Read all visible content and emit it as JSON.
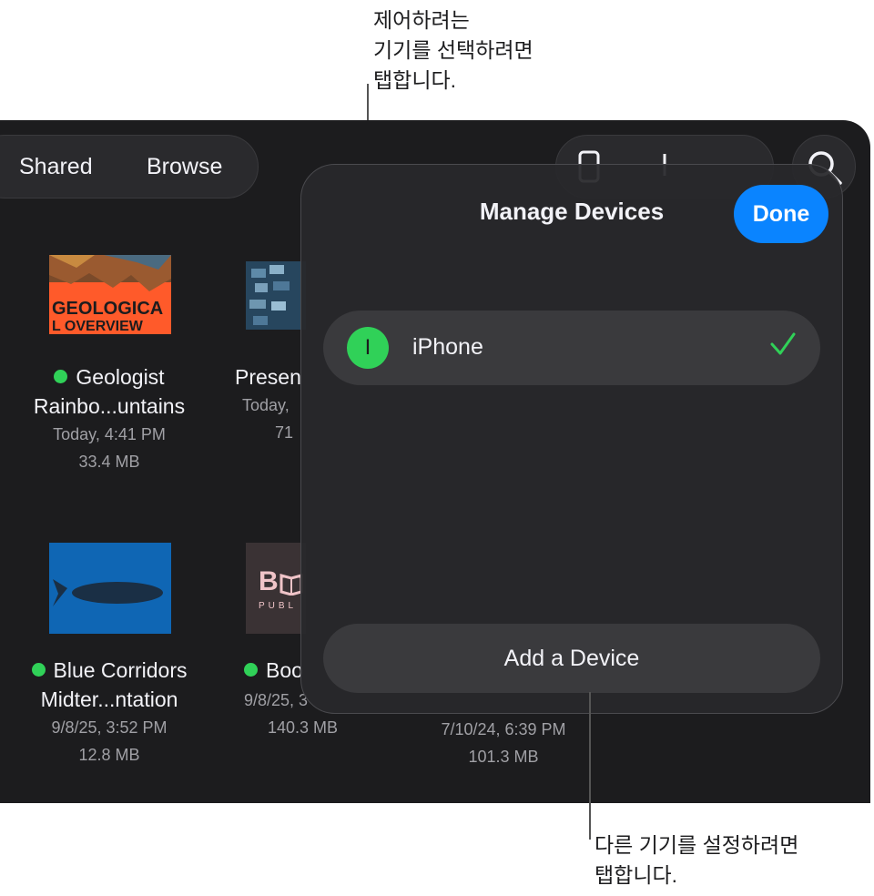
{
  "callouts": {
    "top_lines": [
      "제어하려는",
      "기기를 선택하려면",
      "탭합니다."
    ],
    "bottom_lines": [
      "다른 기기를 설정하려면",
      "탭합니다."
    ]
  },
  "nav": {
    "tab_shared": "Shared",
    "tab_browse": "Browse"
  },
  "files": [
    {
      "name_line1": "Geologist",
      "name_line2": "Rainbo...untains",
      "date": "Today, 4:41 PM",
      "size": "33.4 MB",
      "thumb_text": "GEOLOGICA",
      "thumb_text2": "L OVERVIEW"
    },
    {
      "name_line1": "Presen",
      "date": "Today,",
      "size": "71"
    },
    {
      "name_line1": "Blue Corridors",
      "name_line2": "Midter...ntation",
      "date": "9/8/25, 3:52 PM",
      "size": "12.8 MB"
    },
    {
      "name_line1": "Boo",
      "date": "9/8/25, 3",
      "size": "140.3 MB",
      "thumb_text": "B",
      "thumb_text2": "PUBL"
    },
    {
      "date": "7/10/24, 6:39 PM",
      "size": "101.3 MB"
    }
  ],
  "sheet": {
    "title": "Manage Devices",
    "done_label": "Done",
    "device": {
      "initial": "I",
      "name": "iPhone"
    },
    "add_label": "Add a Device"
  },
  "colors": {
    "accent": "#0a84ff",
    "green": "#30d158",
    "background": "#1c1c1e"
  }
}
